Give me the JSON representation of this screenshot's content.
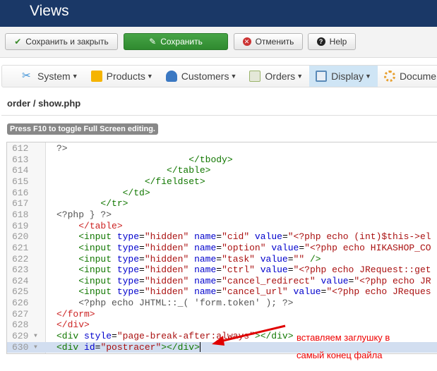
{
  "header": {
    "title": "Views"
  },
  "toolbar": {
    "save_close": "Сохранить и закрыть",
    "save": "Сохранить",
    "cancel": "Отменить",
    "help": "Help"
  },
  "menu": [
    {
      "label": "System",
      "color": "#3a8fd6"
    },
    {
      "label": "Products",
      "color": "#f5b400"
    },
    {
      "label": "Customers",
      "color": "#3b78c2"
    },
    {
      "label": "Orders",
      "color": "#9ab36a"
    },
    {
      "label": "Display",
      "color": "#5a8ab8"
    },
    {
      "label": "Documen",
      "color": "#e8a030"
    }
  ],
  "page_title": "order / show.php",
  "hint": "Press F10 to toggle Full Screen editing.",
  "editor": {
    "lines": [
      {
        "n": "612",
        "seg": [
          [
            "?>",
            "t-php"
          ]
        ]
      },
      {
        "n": "613",
        "seg": [
          [
            "                        ",
            ""
          ],
          [
            "</tbody>",
            "t-tag"
          ]
        ]
      },
      {
        "n": "614",
        "seg": [
          [
            "                    ",
            ""
          ],
          [
            "</table>",
            "t-tag"
          ]
        ]
      },
      {
        "n": "615",
        "seg": [
          [
            "                ",
            ""
          ],
          [
            "</fieldset>",
            "t-tag"
          ]
        ]
      },
      {
        "n": "616",
        "seg": [
          [
            "            ",
            ""
          ],
          [
            "</td>",
            "t-tag"
          ]
        ]
      },
      {
        "n": "617",
        "seg": [
          [
            "        ",
            ""
          ],
          [
            "</tr>",
            "t-tag"
          ]
        ]
      },
      {
        "n": "618",
        "seg": [
          [
            "<?php } ?>",
            "t-php"
          ]
        ]
      },
      {
        "n": "619",
        "seg": [
          [
            "    ",
            ""
          ],
          [
            "</table>",
            "t-ctag"
          ]
        ]
      },
      {
        "n": "620",
        "seg": [
          [
            "    ",
            ""
          ],
          [
            "<input ",
            "t-tag"
          ],
          [
            "type",
            "t-attr"
          ],
          [
            "=",
            ""
          ],
          [
            "\"hidden\"",
            "t-str"
          ],
          [
            " name",
            "t-attr"
          ],
          [
            "=",
            ""
          ],
          [
            "\"cid\"",
            "t-str"
          ],
          [
            " value",
            "t-attr"
          ],
          [
            "=",
            ""
          ],
          [
            "\"<?php echo (int)$this->el",
            "t-str"
          ]
        ]
      },
      {
        "n": "621",
        "seg": [
          [
            "    ",
            ""
          ],
          [
            "<input ",
            "t-tag"
          ],
          [
            "type",
            "t-attr"
          ],
          [
            "=",
            ""
          ],
          [
            "\"hidden\"",
            "t-str"
          ],
          [
            " name",
            "t-attr"
          ],
          [
            "=",
            ""
          ],
          [
            "\"option\"",
            "t-str"
          ],
          [
            " value",
            "t-attr"
          ],
          [
            "=",
            ""
          ],
          [
            "\"<?php echo HIKASHOP_CO",
            "t-str"
          ]
        ]
      },
      {
        "n": "622",
        "seg": [
          [
            "    ",
            ""
          ],
          [
            "<input ",
            "t-tag"
          ],
          [
            "type",
            "t-attr"
          ],
          [
            "=",
            ""
          ],
          [
            "\"hidden\"",
            "t-str"
          ],
          [
            " name",
            "t-attr"
          ],
          [
            "=",
            ""
          ],
          [
            "\"task\"",
            "t-str"
          ],
          [
            " value",
            "t-attr"
          ],
          [
            "=",
            ""
          ],
          [
            "\"\"",
            "t-str"
          ],
          [
            " />",
            "t-tag"
          ]
        ]
      },
      {
        "n": "623",
        "seg": [
          [
            "    ",
            ""
          ],
          [
            "<input ",
            "t-tag"
          ],
          [
            "type",
            "t-attr"
          ],
          [
            "=",
            ""
          ],
          [
            "\"hidden\"",
            "t-str"
          ],
          [
            " name",
            "t-attr"
          ],
          [
            "=",
            ""
          ],
          [
            "\"ctrl\"",
            "t-str"
          ],
          [
            " value",
            "t-attr"
          ],
          [
            "=",
            ""
          ],
          [
            "\"<?php echo JRequest::get",
            "t-str"
          ]
        ]
      },
      {
        "n": "624",
        "seg": [
          [
            "    ",
            ""
          ],
          [
            "<input ",
            "t-tag"
          ],
          [
            "type",
            "t-attr"
          ],
          [
            "=",
            ""
          ],
          [
            "\"hidden\"",
            "t-str"
          ],
          [
            " name",
            "t-attr"
          ],
          [
            "=",
            ""
          ],
          [
            "\"cancel_redirect\"",
            "t-str"
          ],
          [
            " value",
            "t-attr"
          ],
          [
            "=",
            ""
          ],
          [
            "\"<?php echo JR",
            "t-str"
          ]
        ]
      },
      {
        "n": "625",
        "seg": [
          [
            "    ",
            ""
          ],
          [
            "<input ",
            "t-tag"
          ],
          [
            "type",
            "t-attr"
          ],
          [
            "=",
            ""
          ],
          [
            "\"hidden\"",
            "t-str"
          ],
          [
            " name",
            "t-attr"
          ],
          [
            "=",
            ""
          ],
          [
            "\"cancel_url\"",
            "t-str"
          ],
          [
            " value",
            "t-attr"
          ],
          [
            "=",
            ""
          ],
          [
            "\"<?php echo JReques",
            "t-str"
          ]
        ]
      },
      {
        "n": "626",
        "seg": [
          [
            "    ",
            ""
          ],
          [
            "<?php echo JHTML::_( 'form.token' ); ?>",
            "t-php"
          ]
        ]
      },
      {
        "n": "627",
        "seg": [
          [
            "</form>",
            "t-ctag"
          ]
        ]
      },
      {
        "n": "628",
        "seg": [
          [
            "</div>",
            "t-ctag"
          ]
        ]
      },
      {
        "n": "629",
        "fold": true,
        "seg": [
          [
            "<div ",
            "t-tag"
          ],
          [
            "style",
            "t-attr"
          ],
          [
            "=",
            ""
          ],
          [
            "\"page-break-after:always\"",
            "t-str"
          ],
          [
            "></div>",
            "t-tag"
          ]
        ]
      },
      {
        "n": "630",
        "fold": true,
        "active": true,
        "seg": [
          [
            "<div ",
            "t-tag"
          ],
          [
            "id",
            "t-attr"
          ],
          [
            "=",
            ""
          ],
          [
            "\"postracer\"",
            "t-str"
          ],
          [
            "></div>",
            "t-tag"
          ]
        ]
      }
    ]
  },
  "annotation": {
    "line1": "вставляем заглушку в",
    "line2": "самый конец файла",
    "color": "#e00000"
  }
}
